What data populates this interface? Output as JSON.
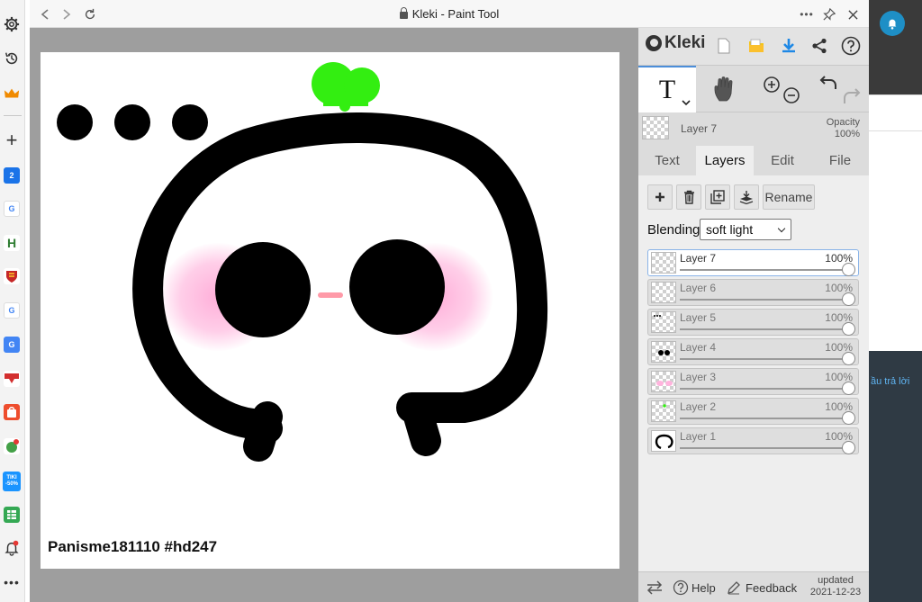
{
  "browser": {
    "window_title": "Kleki - Paint Tool",
    "sidebar": {
      "favicons": [
        {
          "name": "favicon-tab-1",
          "glyph": "2",
          "color": "#1a73e8"
        },
        {
          "name": "favicon-google-1",
          "glyph": "G",
          "color": "#ffffff"
        },
        {
          "name": "favicon-h",
          "glyph": "H",
          "color": "#2e7d32"
        },
        {
          "name": "favicon-shield",
          "glyph": "",
          "color": "#c62828"
        },
        {
          "name": "favicon-google-2",
          "glyph": "G",
          "color": "#ffffff"
        },
        {
          "name": "favicon-translate",
          "glyph": "G",
          "color": "#4285f4"
        },
        {
          "name": "favicon-red",
          "glyph": "",
          "color": "#d32f2f"
        },
        {
          "name": "favicon-shopee",
          "glyph": "",
          "color": "#ee4d2d"
        },
        {
          "name": "favicon-green",
          "glyph": "",
          "color": "#43a047"
        },
        {
          "name": "favicon-tiki",
          "glyph": "TIKI -50%",
          "color": "#1a94ff"
        },
        {
          "name": "favicon-sheets",
          "glyph": "",
          "color": "#34a853"
        }
      ]
    }
  },
  "canvas": {
    "signature": "Panisme181110 #hd247",
    "colors": {
      "outline": "#000000",
      "sprout": "#33ee11",
      "blush": "#ffb3dd",
      "nose": "#ff9aa8"
    }
  },
  "panel": {
    "logo": "Kleki",
    "layer_info": {
      "name": "Layer 7",
      "opacity_label": "Opacity",
      "opacity_value": "100%"
    },
    "tabs": [
      "Text",
      "Layers",
      "Edit",
      "File"
    ],
    "active_tab": "Layers",
    "actions": {
      "rename_label": "Rename"
    },
    "blending": {
      "label": "Blending",
      "value": "soft light"
    },
    "layers": [
      {
        "name": "Layer 7",
        "opacity": "100%",
        "active": true
      },
      {
        "name": "Layer 6",
        "opacity": "100%",
        "active": false
      },
      {
        "name": "Layer 5",
        "opacity": "100%",
        "active": false
      },
      {
        "name": "Layer 4",
        "opacity": "100%",
        "active": false
      },
      {
        "name": "Layer 3",
        "opacity": "100%",
        "active": false
      },
      {
        "name": "Layer 2",
        "opacity": "100%",
        "active": false
      },
      {
        "name": "Layer 1",
        "opacity": "100%",
        "active": false
      }
    ],
    "bottom": {
      "help_label": "Help",
      "feedback_label": "Feedback",
      "updated_label": "updated",
      "updated_date": "2021-12-23"
    }
  },
  "background_page": {
    "snippet": "ầu trả lời"
  }
}
